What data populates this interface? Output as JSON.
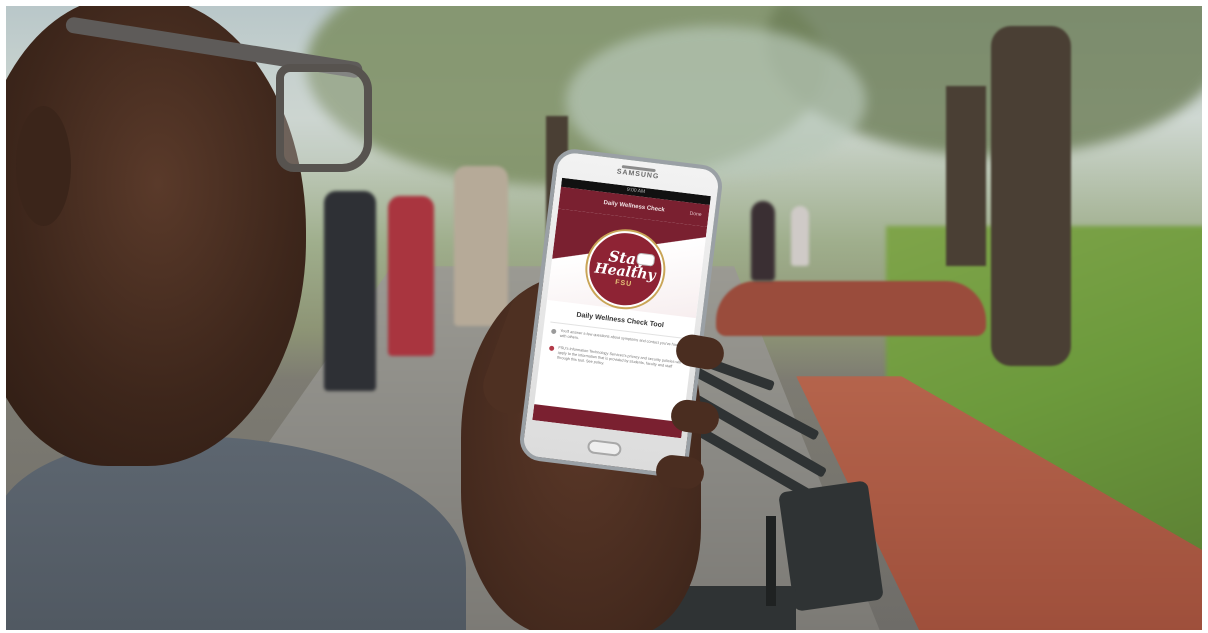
{
  "scene": {
    "description_colors": {
      "lawn": "#6c9a3c",
      "brick": "#9e4f3b",
      "fsu_garnet": "#7a2030",
      "fsu_gold": "#c9a557"
    }
  },
  "phone": {
    "brand": "SAMSUNG",
    "status_time": "9:00 AM",
    "app_bar": {
      "title": "Daily Wellness Check",
      "done_label": "Done"
    },
    "logo": {
      "line1": "Stay",
      "line2": "Healthy",
      "line3": "FSU"
    },
    "tool_title": "Daily Wellness Check Tool",
    "notes": [
      "You'll answer a few questions about symptoms and contact you've had with others.",
      "FSU's Information Technology Services's privacy and security policies will apply to the information that is provided by students, faculty and staff through this tool. See policy."
    ]
  }
}
